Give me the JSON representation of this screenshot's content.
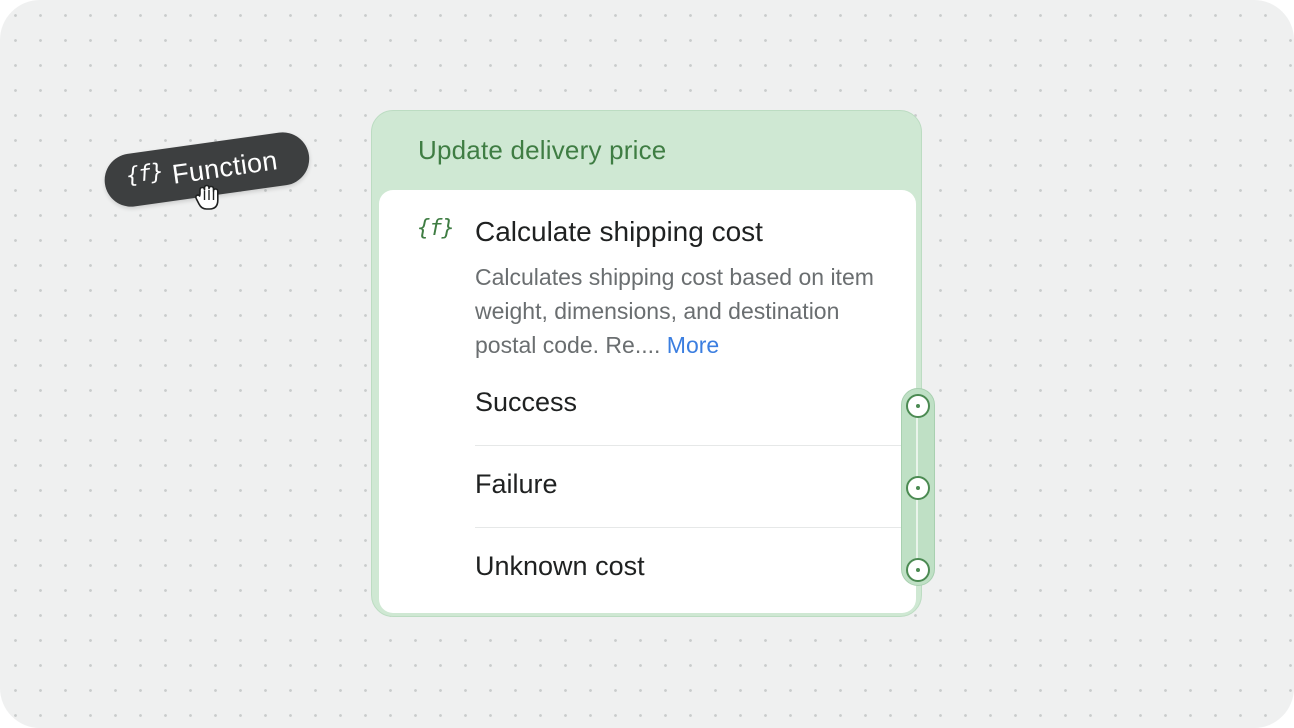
{
  "palette_chip": {
    "icon": "function-icon",
    "icon_glyph": "{f}",
    "label": "Function",
    "cursor": "grab-hand-cursor-icon"
  },
  "node": {
    "title": "Update delivery price",
    "function": {
      "icon": "function-icon",
      "icon_glyph": "{f}",
      "title": "Calculate shipping cost",
      "description": "Calculates shipping cost based on item weight, dimensions, and destination postal code. Re....",
      "more_label": "More"
    },
    "outputs": [
      {
        "label": "Success"
      },
      {
        "label": "Failure"
      },
      {
        "label": "Unknown cost"
      }
    ]
  },
  "colors": {
    "canvas_bg": "#eff0f0",
    "chip_bg": "#3d3f40",
    "node_header_bg": "#cfe8d3",
    "node_title": "#3f7d43",
    "link": "#3b7ee0",
    "port_border": "#4b8a52"
  }
}
